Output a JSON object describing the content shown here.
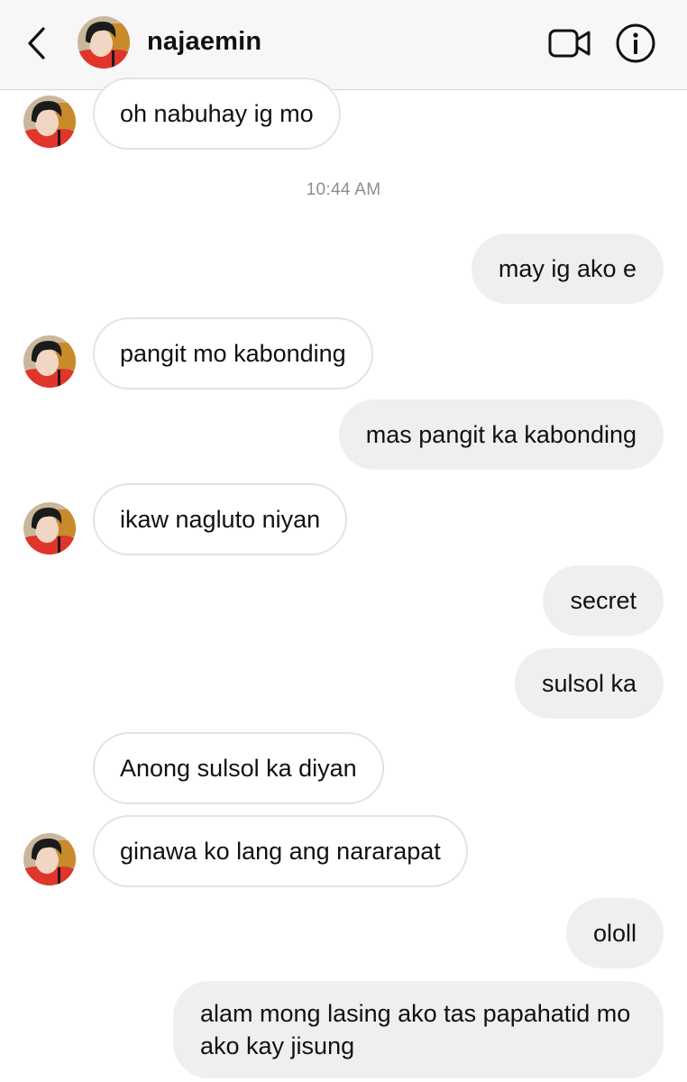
{
  "header": {
    "username": "najaemin",
    "back_icon": "chevron-left-icon",
    "video_icon": "video-camera-icon",
    "info_icon": "info-circle-icon"
  },
  "conversation": {
    "timestamp": "10:44 AM",
    "messages": [
      {
        "direction": "incoming",
        "text": "oh nabuhay ig mo"
      },
      {
        "direction": "outgoing",
        "text": "may ig ako e"
      },
      {
        "direction": "incoming",
        "text": "pangit mo kabonding"
      },
      {
        "direction": "outgoing",
        "text": "mas pangit ka kabonding"
      },
      {
        "direction": "incoming",
        "text": "ikaw nagluto niyan"
      },
      {
        "direction": "outgoing",
        "text": "secret"
      },
      {
        "direction": "outgoing",
        "text": "sulsol ka"
      },
      {
        "direction": "incoming",
        "text": "Anong sulsol ka diyan"
      },
      {
        "direction": "incoming",
        "text": "ginawa ko lang ang nararapat"
      },
      {
        "direction": "outgoing",
        "text": "ololl"
      },
      {
        "direction": "outgoing",
        "text": "alam mong lasing ako tas papahatid mo ako kay jisung"
      }
    ]
  },
  "colors": {
    "header_bg": "#f7f7f7",
    "incoming_border": "#e3e3e3",
    "outgoing_bg": "#efefef",
    "timestamp": "#8e8e8e",
    "avatar_accent": "#e0352b"
  }
}
